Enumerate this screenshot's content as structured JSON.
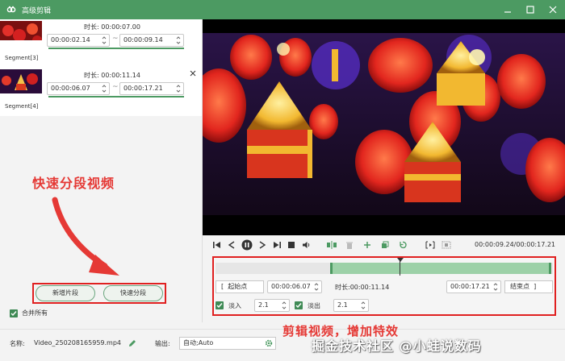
{
  "window": {
    "title": "高级剪辑",
    "brand_color": "#4c9a62"
  },
  "segments": [
    {
      "label": "Segment[3]",
      "duration_label": "时长:",
      "duration": "00:00:07.00",
      "start": "00:00:02.14",
      "end": "00:00:09.14",
      "tilde": "~"
    },
    {
      "label": "Segment[4]",
      "duration_label": "时长:",
      "duration": "00:00:11.14",
      "start": "00:00:06.07",
      "end": "00:00:17.21",
      "tilde": "~"
    }
  ],
  "annotations": {
    "left": "快速分段视频",
    "right": "剪辑视频，增加特效"
  },
  "buttons": {
    "add_segment": "新增片段",
    "quick_split": "快速分段"
  },
  "merge_all": {
    "label": "合并所有",
    "checked": true
  },
  "player": {
    "time": "00:00:09.24/00:00:17.21",
    "icons": [
      "skip-start-icon",
      "step-back-icon",
      "pause-icon",
      "step-forward-icon",
      "stop-icon",
      "volume-icon",
      "split-icon",
      "delete-icon",
      "add-icon",
      "copy-icon",
      "undo-icon",
      "trim-icon",
      "crop-icon"
    ]
  },
  "timeline": {
    "start_btn": "起始点",
    "start_time": "00:00:06.07",
    "duration_label": "时长:",
    "duration": "00:00:11.14",
    "end_time": "00:00:17.21",
    "end_btn": "结束点",
    "fade_in_label": "淡入",
    "fade_in_value": "2.1",
    "fade_out_label": "淡出",
    "fade_out_value": "2.1",
    "bracket_open": "[",
    "bracket_close": "]"
  },
  "bottom": {
    "name_label": "名称:",
    "name_value": "Video_250208165959.mp4",
    "output_label": "输出:",
    "output_value": "自动;Auto"
  },
  "watermark": "掘金技术社区 @小蛙说数码"
}
